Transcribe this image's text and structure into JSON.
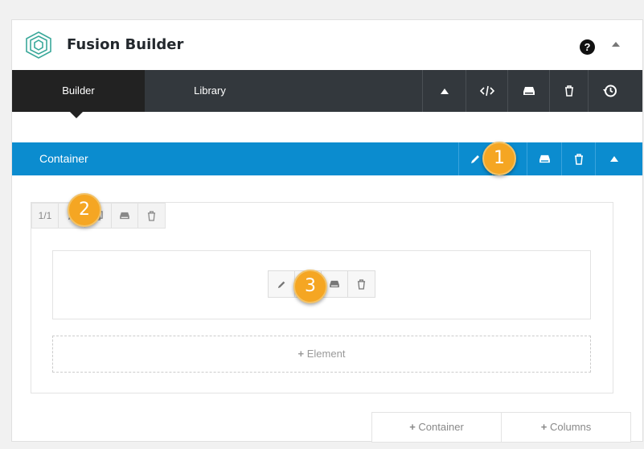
{
  "header": {
    "title": "Fusion Builder",
    "help_icon": "?"
  },
  "tabs": [
    {
      "label": "Builder"
    },
    {
      "label": "Library"
    }
  ],
  "container": {
    "label": "Container"
  },
  "column": {
    "fraction": "1/1"
  },
  "add_element": {
    "label": "Element"
  },
  "bottom_buttons": {
    "container": "Container",
    "columns": "Columns"
  },
  "badges": [
    "1",
    "2",
    "3"
  ],
  "colors": {
    "accent": "#0b8ccf",
    "toolbar": "#33383d",
    "badge": "#f5a623"
  }
}
